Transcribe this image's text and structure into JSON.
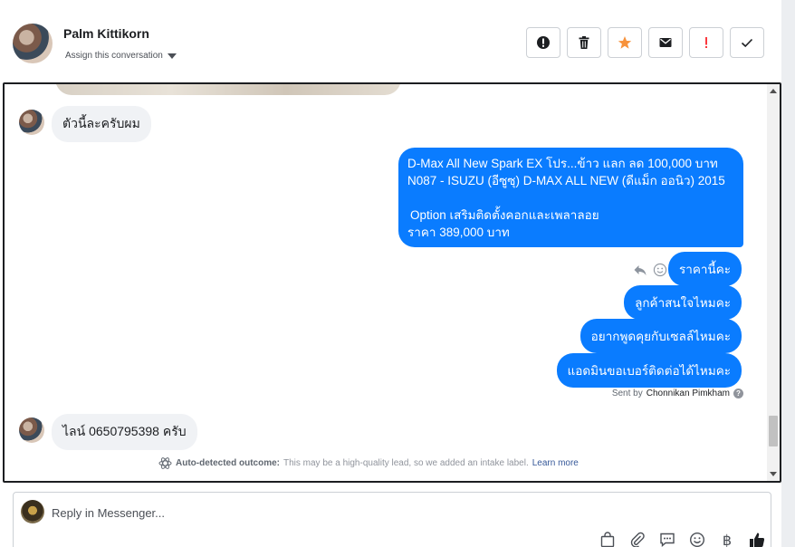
{
  "header": {
    "contact_name": "Palm Kittikorn",
    "assign_label": "Assign this conversation",
    "actions": [
      {
        "icon": "alert-circle-icon"
      },
      {
        "icon": "trash-icon"
      },
      {
        "icon": "star-icon",
        "color": "#f7923b"
      },
      {
        "icon": "envelope-icon"
      },
      {
        "icon": "exclamation-icon",
        "color": "#fa383e"
      },
      {
        "icon": "checkmark-icon"
      }
    ]
  },
  "messages": {
    "in_1": "ตัวนี้ละครับผม",
    "out_big": {
      "line1": "D-Max All New Spark EX โปร...ข้าว แลก ลด 100,000 บาท",
      "line2": "N087 - ISUZU (อีซูซุ) D-MAX ALL NEW (ดีแม็ก ออนิว) 2015",
      "line3": "Option เสริมติดตั้งคอกและเพลาลอย",
      "line4": "ราคา 389,000 บาท"
    },
    "out_2": "ราคานี้คะ",
    "out_3": "ลูกค้าสนใจไหมคะ",
    "out_4": "อยากพูดคุยกับเซลล์ไหมคะ",
    "out_5": "แอดมินขอเบอร์ติดต่อได้ไหมคะ",
    "sent_by_prefix": "Sent by",
    "sent_by_name": "Chonnikan Pimkham",
    "in_2": "ไลน์ 0650795398 ครับ"
  },
  "outcome": {
    "label": "Auto-detected outcome:",
    "text": "This may be a high-quality lead, so we added an intake label.",
    "learn_more": "Learn more"
  },
  "reply": {
    "placeholder": "Reply in Messenger...",
    "baht_symbol": "฿"
  },
  "colors": {
    "outgoing_bubble": "#0a7cff",
    "incoming_bubble": "#f0f2f5",
    "like_icon": "#1c1e21"
  }
}
